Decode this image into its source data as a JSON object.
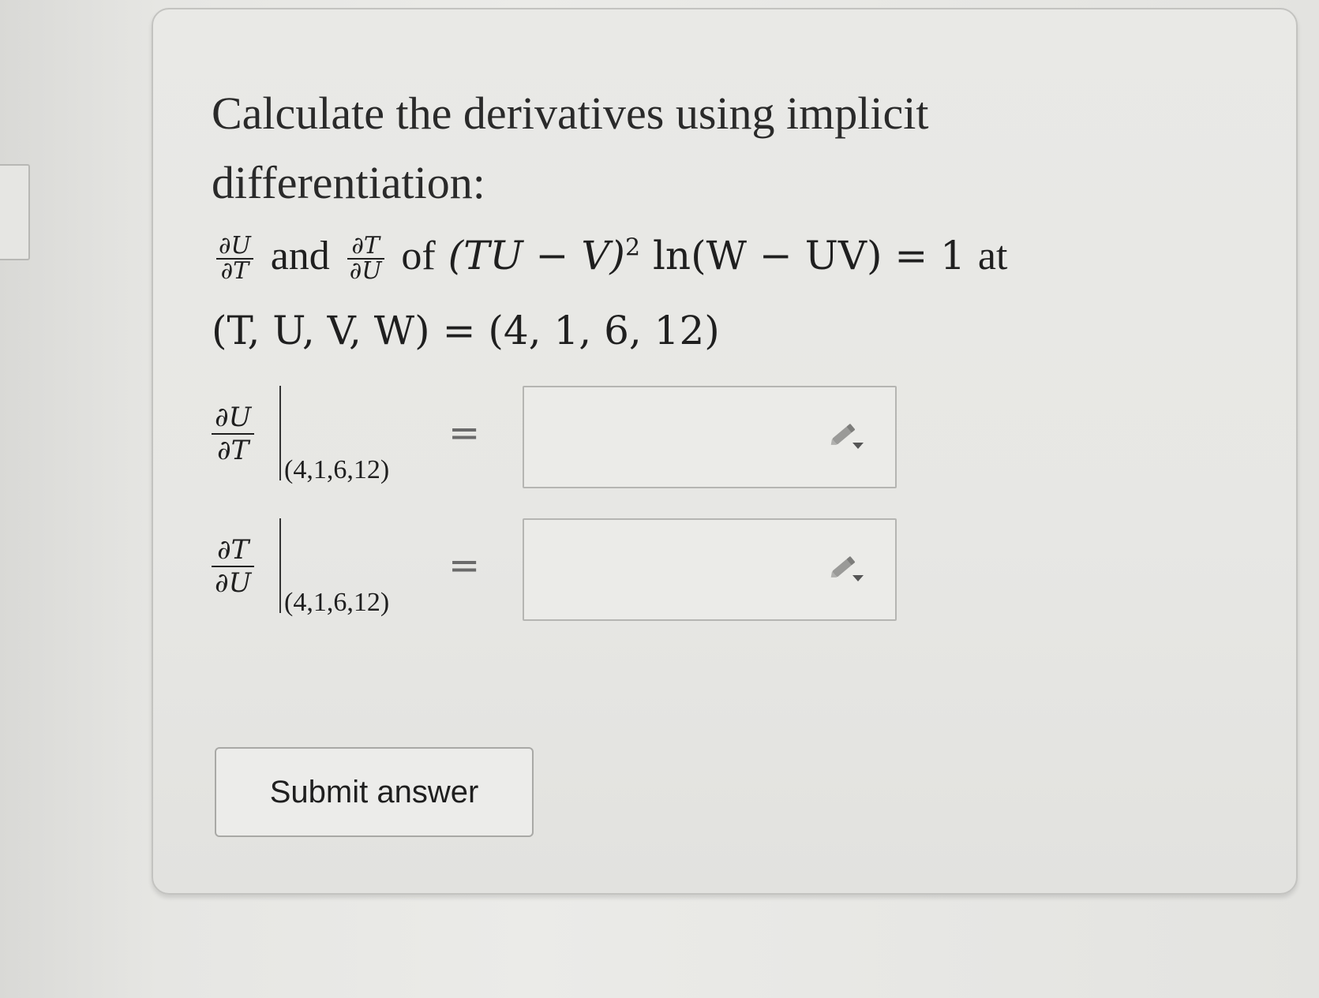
{
  "question": {
    "line1": "Calculate the derivatives using implicit",
    "line2": "differentiation:"
  },
  "statement": {
    "frac1_num": "∂U",
    "frac1_den": "∂T",
    "and_word": "and",
    "frac2_num": "∂T",
    "frac2_den": "∂U",
    "of_word": "of",
    "equation_a": "(TU − V)",
    "exponent": "2",
    "equation_b": "ln(W − UV) = 1",
    "at_word": "at",
    "point_line": "(T, U, V, W) = (4, 1, 6, 12)"
  },
  "answers": [
    {
      "num": "∂U",
      "den": "∂T",
      "point": "(4,1,6,12)",
      "equals": "=",
      "value": "",
      "icon": "pencil-dropdown-icon"
    },
    {
      "num": "∂T",
      "den": "∂U",
      "point": "(4,1,6,12)",
      "equals": "=",
      "value": "",
      "icon": "pencil-dropdown-icon"
    }
  ],
  "submit": {
    "label": "Submit answer"
  }
}
